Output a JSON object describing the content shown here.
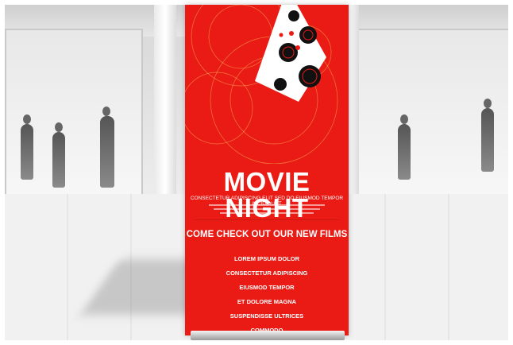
{
  "poster": {
    "title": "MOVIE NIGHT",
    "tagline": "CONSECTETUR ADIPISCING ELIT SED DO EIUSMOD TEMPOR INCIDIDUNT",
    "headline": "COME CHECK OUT OUR NEW FILMS",
    "items": [
      "LOREM IPSUM DOLOR",
      "CONSECTETUR ADIPISCING",
      "EIUSMOD TEMPOR",
      "ET DOLORE MAGNA",
      "SUSPENDISSE ULTRICES",
      "COMMODO"
    ]
  },
  "colors": {
    "banner_red": "#ea1b14",
    "reel_white": "#ffffff",
    "reel_black": "#111111"
  },
  "icons": [
    "film-reel-icon"
  ]
}
